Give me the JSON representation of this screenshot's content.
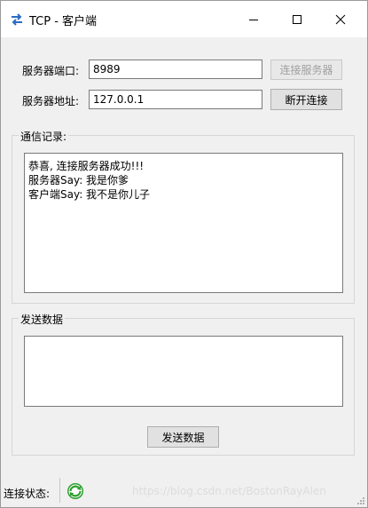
{
  "window": {
    "title": "TCP - 客户端",
    "icon": "network-arrows-icon"
  },
  "connection": {
    "port_label": "服务器端口:",
    "port_value": "8989",
    "address_label": "服务器地址:",
    "address_value": "127.0.0.1",
    "connect_button": "连接服务器",
    "disconnect_button": "断开连接"
  },
  "log": {
    "legend": "通信记录:",
    "lines": [
      "恭喜, 连接服务器成功!!!",
      "服务器Say: 我是你爹",
      "客户端Say: 我不是你儿子"
    ]
  },
  "send": {
    "legend": "发送数据",
    "input_value": "",
    "button": "发送数据"
  },
  "status": {
    "label": "连接状态:",
    "icon": "connected-refresh-icon",
    "icon_color": "#2e9e2e"
  },
  "watermark": "https://blog.csdn.net/BostonRayAlen"
}
